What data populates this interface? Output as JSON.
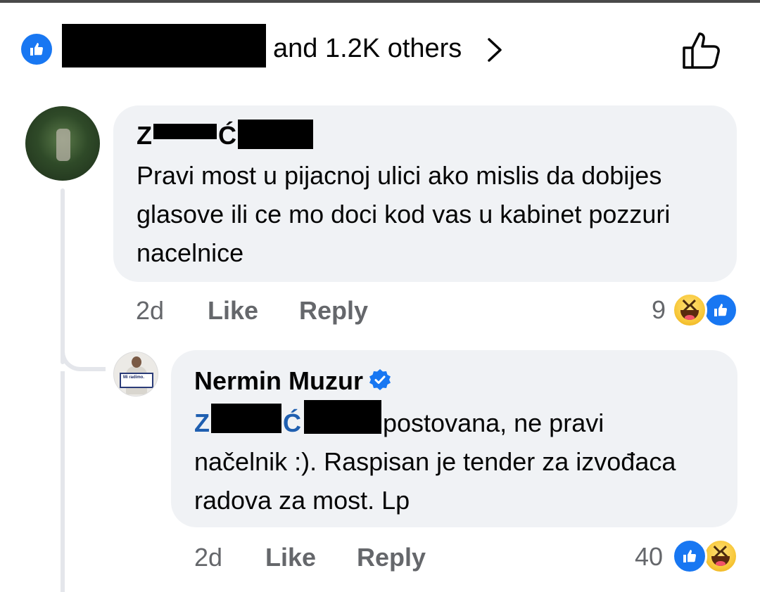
{
  "reactions_summary": {
    "likers_text": "and 1.2K others"
  },
  "comment1": {
    "author_visible_start": "Z",
    "author_visible_mid": "Ć",
    "body": "Pravi most u pijacnoj ulici ako mislis da dobijes glasove ili ce mo doci kod vas u kabinet pozzuri nacelnice",
    "time": "2d",
    "like_label": "Like",
    "reply_label": "Reply",
    "reaction_count": "9",
    "reactions": [
      "haha-icon",
      "like-icon"
    ]
  },
  "reply1": {
    "author": "Nermin Muzur",
    "avatar_sign_text": "Mi radimo.",
    "mention_start": "Z",
    "mention_mid": "Ć",
    "body": "postovana, ne pravi načelnik :). Raspisan je tender za izvođaca radova za most. Lp",
    "time": "2d",
    "like_label": "Like",
    "reply_label": "Reply",
    "reaction_count": "40",
    "reactions": [
      "like-icon",
      "haha-icon"
    ]
  },
  "colors": {
    "accent": "#1877f2",
    "bubble": "#f0f2f5",
    "meta_text": "#65676b",
    "mention": "#1f5fb0"
  }
}
